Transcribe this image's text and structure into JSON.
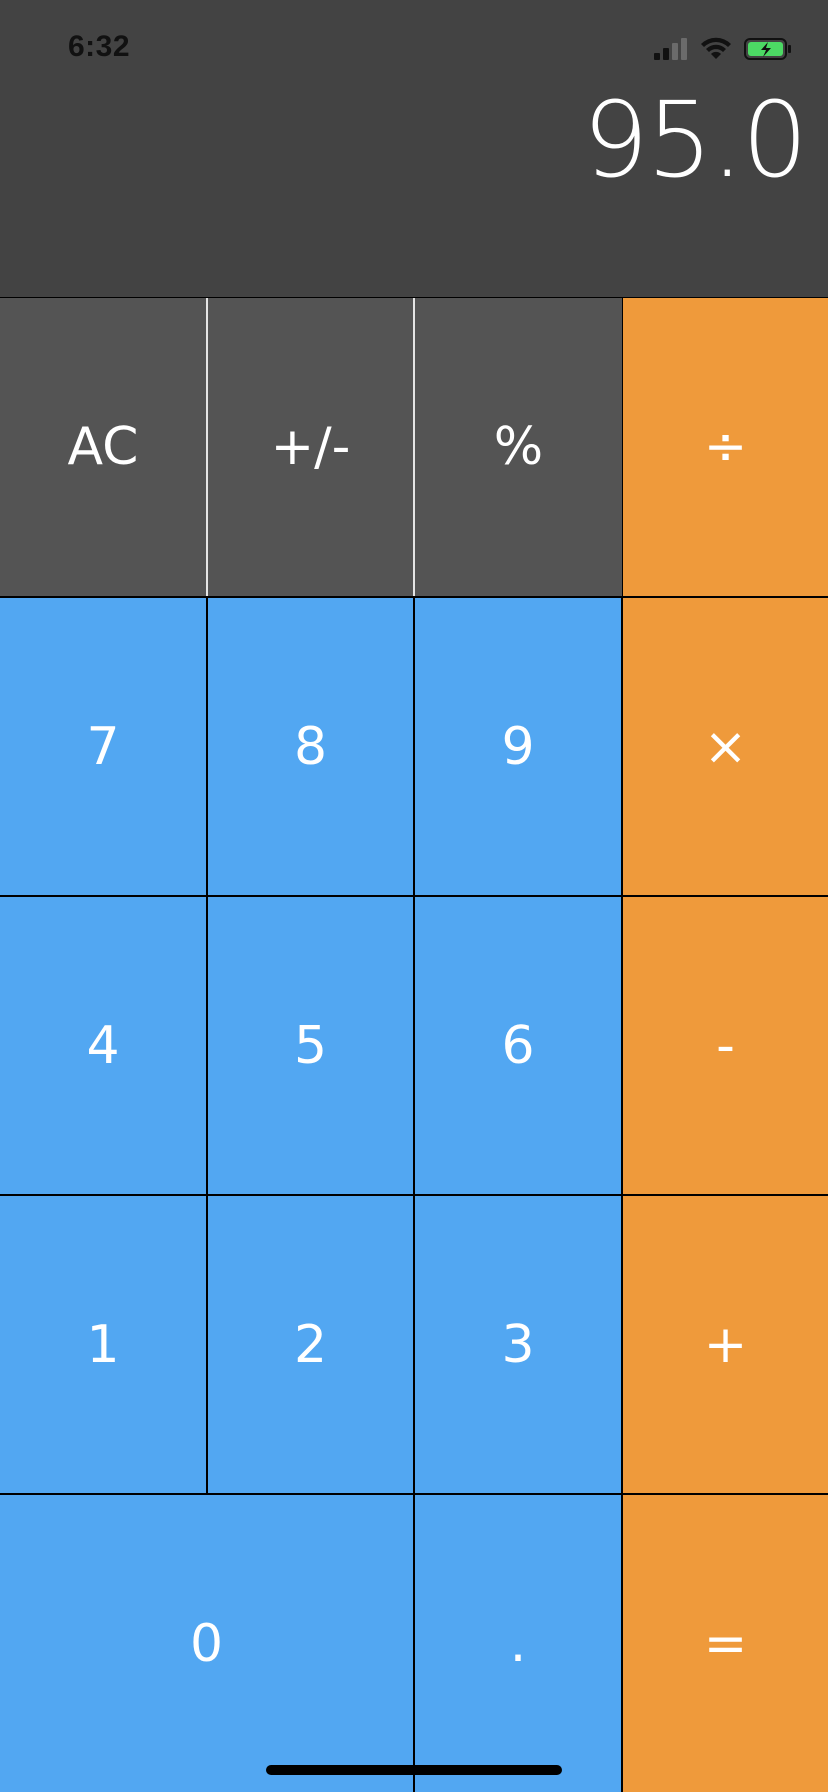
{
  "status_bar": {
    "time": "6:32",
    "icons": [
      "signal-bars-icon",
      "wifi-icon",
      "battery-charging-icon"
    ]
  },
  "display": {
    "value": "95.0"
  },
  "keys": {
    "ac": "AC",
    "sign": "+/-",
    "percent": "%",
    "divide": "÷",
    "seven": "7",
    "eight": "8",
    "nine": "9",
    "multiply": "×",
    "four": "4",
    "five": "5",
    "six": "6",
    "subtract": "-",
    "one": "1",
    "two": "2",
    "three": "3",
    "add": "+",
    "zero": "0",
    "decimal": ".",
    "equals": "="
  },
  "colors": {
    "display_bg": "#434343",
    "function_key": "#545454",
    "number_key": "#52a7f2",
    "operator_key": "#ef9a3b"
  }
}
